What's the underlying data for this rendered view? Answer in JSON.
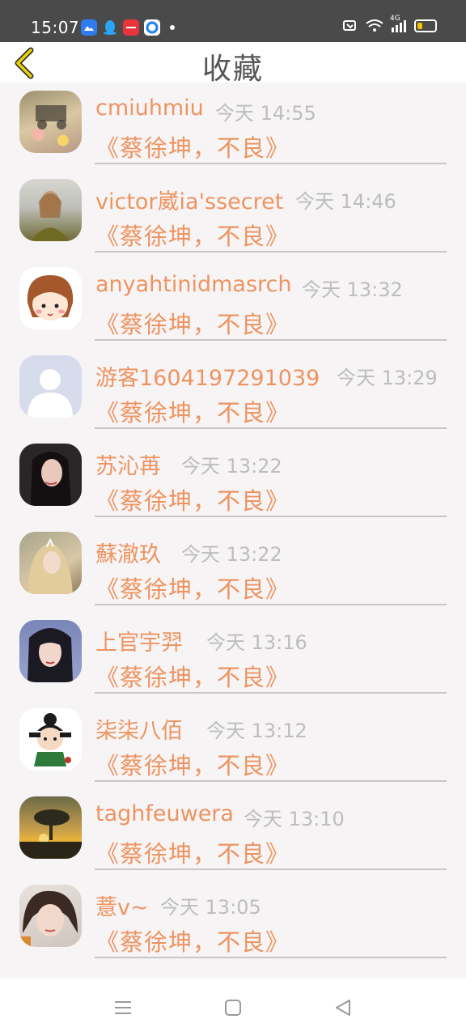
{
  "status_bar": {
    "time": "15:07",
    "network": "4G",
    "battery_color": "#f2c200"
  },
  "header": {
    "title": "收藏",
    "back_icon": "chevron-left-icon"
  },
  "favorites": [
    {
      "name": "cmiuhmiu",
      "time": "今天 14:55",
      "content": "《蔡徐坤，不良》"
    },
    {
      "name": "victor崴ia'ssecret",
      "time": "今天 14:46",
      "content": "《蔡徐坤，不良》"
    },
    {
      "name": "anyahtinidmasrch",
      "time": "今天 13:32",
      "content": "《蔡徐坤，不良》"
    },
    {
      "name": "游客1604197291039",
      "time": "今天 13:29",
      "content": "《蔡徐坤，不良》"
    },
    {
      "name": "苏沁苒",
      "time": "今天 13:22",
      "content": "《蔡徐坤，不良》"
    },
    {
      "name": "蘇澈玖",
      "time": "今天 13:22",
      "content": "《蔡徐坤，不良》"
    },
    {
      "name": "上官宇羿",
      "time": "今天 13:16",
      "content": "《蔡徐坤，不良》"
    },
    {
      "name": "柒柒八佰",
      "time": "今天 13:12",
      "content": "《蔡徐坤，不良》"
    },
    {
      "name": "taghfeuwera",
      "time": "今天 13:10",
      "content": "《蔡徐坤，不良》"
    },
    {
      "name": "薏v~",
      "time": "今天 13:05",
      "content": "《蔡徐坤，不良》"
    }
  ],
  "nav_bar": {
    "icons": [
      "menu-icon",
      "home-square-icon",
      "back-triangle-icon"
    ]
  },
  "colors": {
    "accent": "#ed9460",
    "time_text": "#bdbdbd",
    "back_arrow": "#e8c800"
  }
}
